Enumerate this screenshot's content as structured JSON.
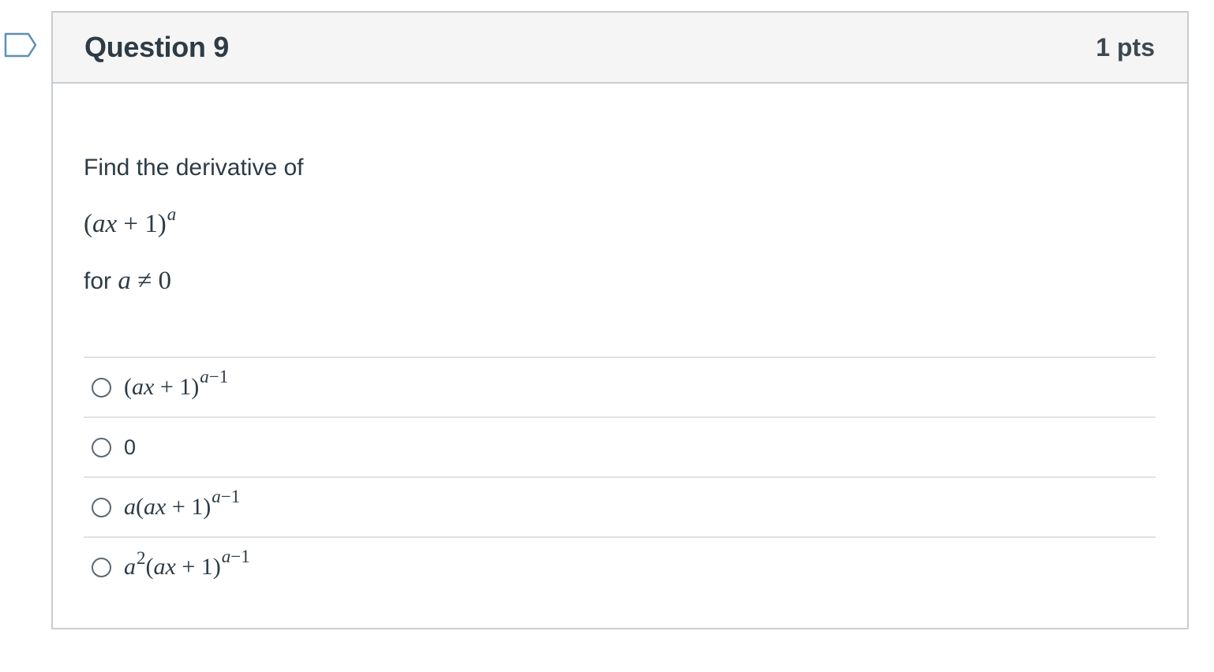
{
  "question": {
    "title": "Question 9",
    "points": "1 pts",
    "flag_icon": "flag-icon",
    "prompt": {
      "intro": "Find the derivative of",
      "expression": {
        "base": "(ax + 1)",
        "exponent": "a"
      },
      "condition_prefix": "for",
      "condition_math": "a ≠ 0"
    },
    "answers": [
      {
        "base": "(ax + 1)",
        "exponent": "a−1"
      },
      {
        "text": "0"
      },
      {
        "base": "a(ax + 1)",
        "exponent": "a−1"
      },
      {
        "base_prefix": "a",
        "prefix_exponent": "2",
        "base": "(ax + 1)",
        "exponent": "a−1"
      }
    ]
  },
  "colors": {
    "header_bg": "#f5f5f5",
    "border": "#c7cdd1",
    "text": "#2d3b45",
    "flag_outline": "#5d8fb5"
  }
}
